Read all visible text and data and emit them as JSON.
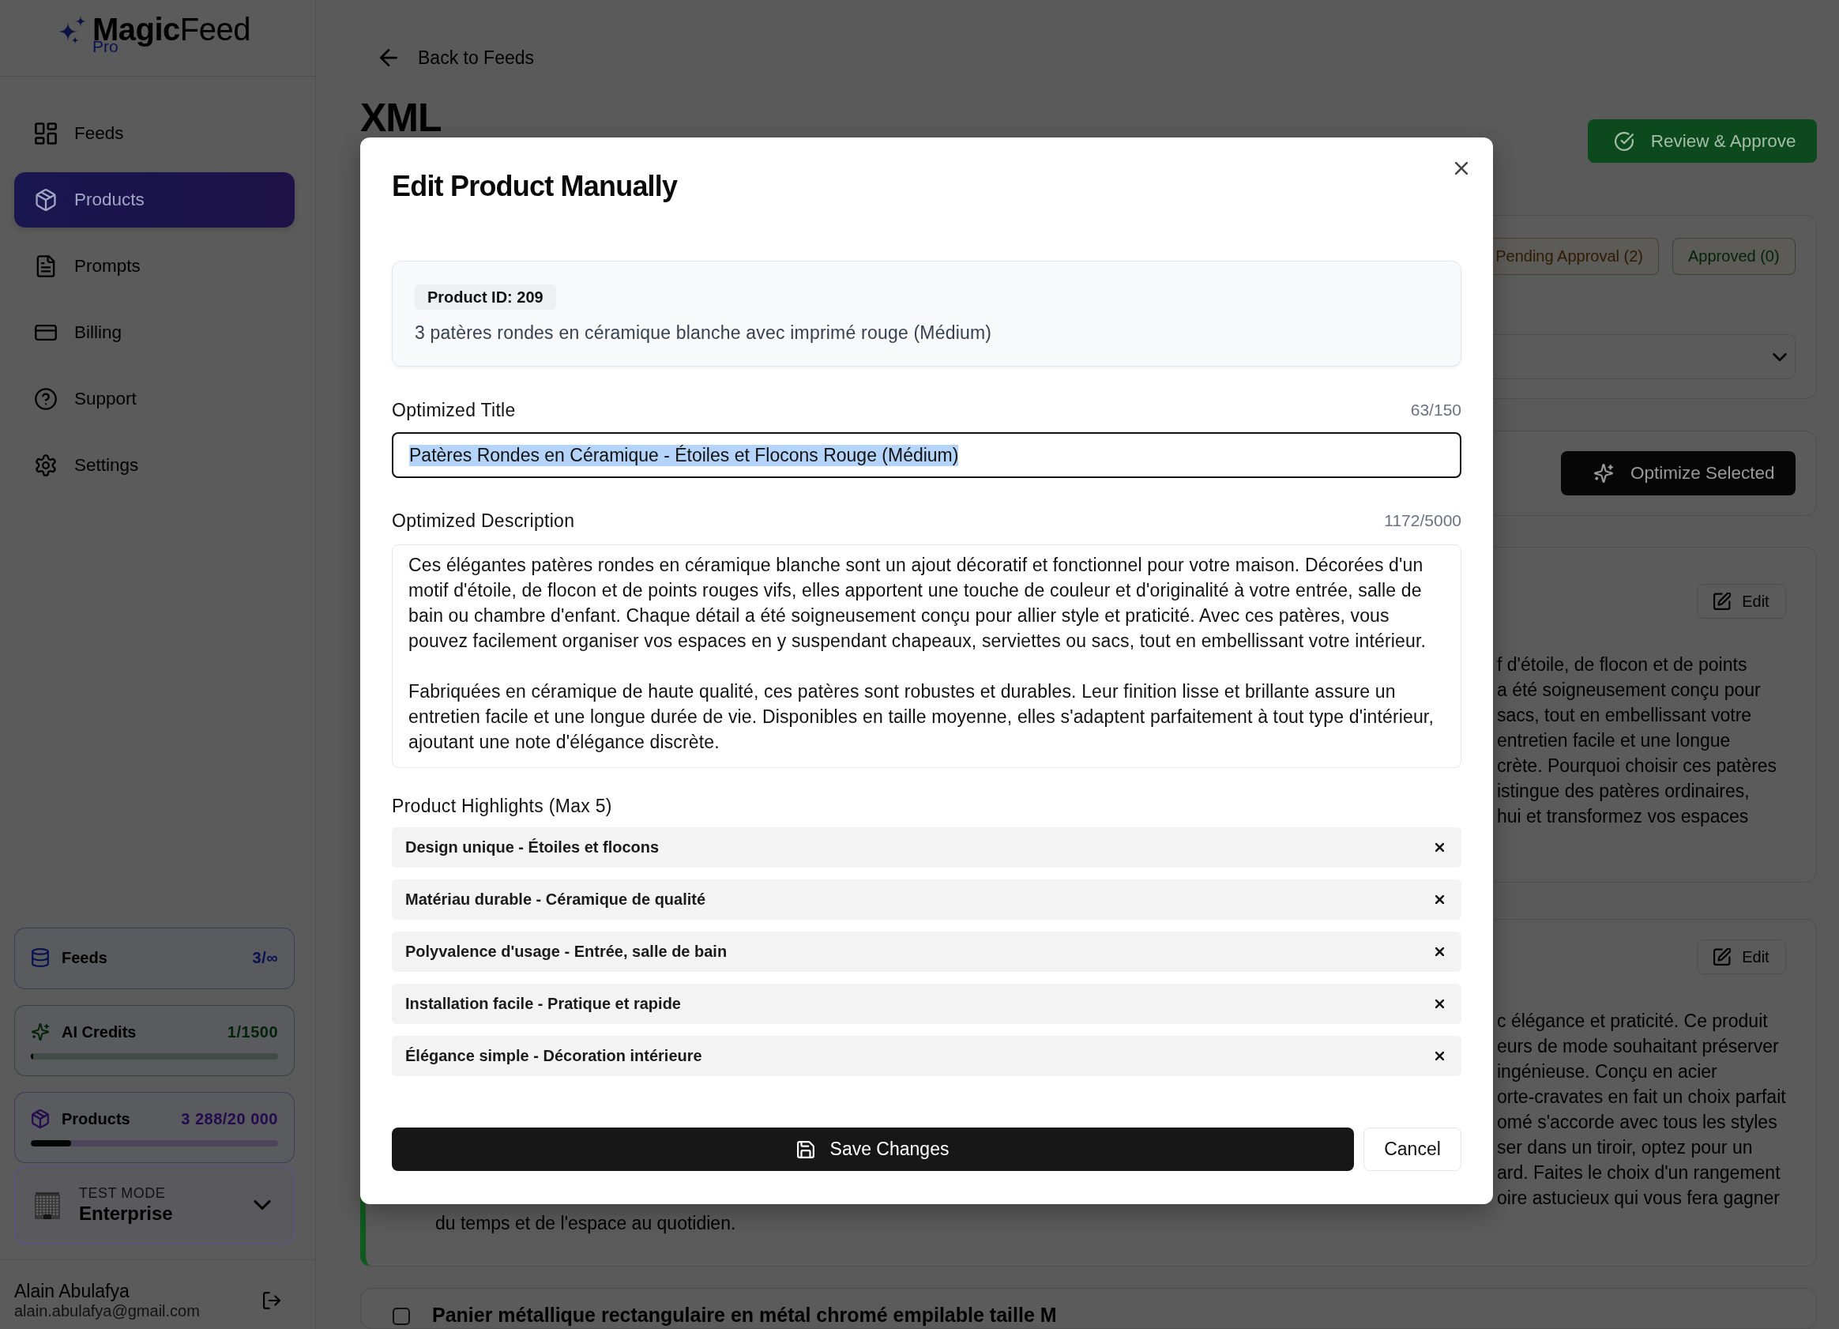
{
  "sidebar": {
    "logo": {
      "wordmark": "**Magic**Feed",
      "badge": "Pro"
    },
    "nav": [
      {
        "label": "Feeds",
        "selected": false
      },
      {
        "label": "Products",
        "selected": true
      },
      {
        "label": "Prompts",
        "selected": false
      },
      {
        "label": "Billing",
        "selected": false
      },
      {
        "label": "Support",
        "selected": false
      },
      {
        "label": "Settings",
        "selected": false
      }
    ],
    "usage": [
      {
        "label": "Feeds",
        "value": "3/∞",
        "color": "#081250"
      },
      {
        "label": "AI Credits",
        "value": "1/1500",
        "color": "#032208",
        "level": 0.0007
      },
      {
        "label": "Products",
        "value": "3 288/20 000",
        "color": "#240a4e",
        "level": 0.1644
      }
    ],
    "plan": {
      "label": "TEST MODE",
      "value": "Enterprise"
    },
    "user": {
      "name": "Alain Abulafya",
      "email": "alain.abulafya@gmail.com"
    }
  },
  "main": {
    "back_link": "Back to Feeds",
    "heading": "XML",
    "review_button": "Review & Approve",
    "status_tabs": [
      {
        "label": "Pending Approval (2)",
        "selected": false,
        "color": "#2e1a00"
      },
      {
        "label": "Approved (0)",
        "selected": false,
        "color": "#032208"
      }
    ],
    "optimize_button": "Optimize Selected",
    "cards": [
      {
        "edit_label": "Edit",
        "visible_lines": [
          "f d'étoile, de flocon et de points",
          "a été soigneusement conçu pour",
          "sacs, tout en embellissant votre",
          "entretien facile et une longue",
          "crète. Pourquoi choisir ces patères",
          "istingue des patères ordinaires,",
          "hui et transformez vos espaces"
        ]
      },
      {
        "edit_label": "Edit",
        "accent_border": true,
        "visible_lines": [
          "c élégance et praticité. Ce produit",
          "eurs de mode souhaitant préserver",
          "ingénieuse. Conçu en acier",
          "orte-cravates en fait un choix parfait",
          "omé s'accorde avec tous les styles",
          "ser dans un tiroir, optez pour un",
          "ard. Faites le choix d'un rangement",
          "oire astucieux qui vous fera gagner"
        ],
        "last_line": "du temps et de l'espace au quotidien."
      }
    ],
    "next_product": {
      "checked": false,
      "title": "Panier métallique rectangulaire en métal chromé empilable taille M"
    }
  },
  "modal": {
    "title": "Edit Product Manually",
    "product_id": "Product ID: 209",
    "original_name": "3 patères rondes en céramique blanche avec imprimé rouge (Médium)",
    "title_field": {
      "label": "Optimized Title",
      "count": "63/150",
      "value": "Patères Rondes en Céramique - Étoiles et Flocons Rouge (Médium)",
      "focused": true,
      "value_selected": true
    },
    "description_field": {
      "label": "Optimized Description",
      "count": "1172/5000",
      "focused": false,
      "value": "Ces élégantes patères rondes en céramique blanche sont un ajout décoratif et fonctionnel pour votre maison. Décorées d'un motif d'étoile, de flocon et de points rouges vifs, elles apportent une touche de couleur et d'originalité à votre entrée, salle de bain ou chambre d'enfant. Chaque détail a été soigneusement conçu pour allier style et praticité. Avec ces patères, vous pouvez facilement organiser vos espaces en y suspendant chapeaux, serviettes ou sacs, tout en embellissant votre intérieur.\n\nFabriquées en céramique de haute qualité, ces patères sont robustes et durables. Leur finition lisse et brillante assure un entretien facile et une longue durée de vie. Disponibles en taille moyenne, elles s'adaptent parfaitement à tout type d'intérieur, ajoutant une note d'élégance discrète."
    },
    "highlights": {
      "label": "Product Highlights (Max 5)",
      "items": [
        "Design unique - Étoiles et flocons",
        "Matériau durable - Céramique de qualité",
        "Polyvalence d'usage - Entrée, salle de bain",
        "Installation facile - Pratique et rapide",
        "Élégance simple - Décoration intérieure"
      ]
    },
    "save_button": "Save Changes",
    "cancel_button": "Cancel"
  }
}
